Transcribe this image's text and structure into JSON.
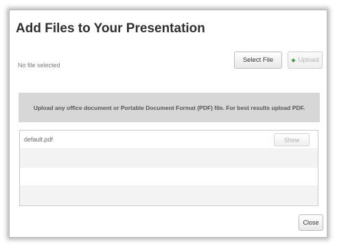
{
  "dialog": {
    "title": "Add Files to Your Presentation",
    "file_status": "No file selected",
    "select_file_label": "Select File",
    "upload_label": "Upload",
    "upload_icon": "upload-arrow-icon",
    "info_text": "Upload any office document or Portable Document Format (PDF) file.  For best results upload PDF.",
    "files": [
      {
        "name": "default.pdf",
        "action_label": "Show"
      },
      {
        "name": "",
        "action_label": ""
      },
      {
        "name": "",
        "action_label": ""
      },
      {
        "name": "",
        "action_label": ""
      }
    ],
    "close_label": "Close"
  }
}
